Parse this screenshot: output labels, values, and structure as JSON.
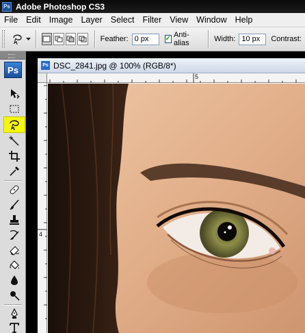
{
  "titlebar": {
    "app_icon": "Ps",
    "title": "Adobe Photoshop CS3"
  },
  "menu": [
    "File",
    "Edit",
    "Image",
    "Layer",
    "Select",
    "Filter",
    "View",
    "Window",
    "Help"
  ],
  "options": {
    "feather_label": "Feather:",
    "feather_value": "0 px",
    "antialias_label": "Anti-alias",
    "antialias_checked": true,
    "width_label": "Width:",
    "width_value": "10 px",
    "contrast_label": "Contrast:"
  },
  "toolbox": {
    "logo": "Ps",
    "tools": [
      "move-tool",
      "marquee-tool",
      "magnetic-lasso-tool",
      "magic-wand-tool",
      "crop-tool",
      "eyedropper-tool",
      "healing-brush-tool",
      "brush-tool",
      "clone-stamp-tool",
      "history-brush-tool",
      "eraser-tool",
      "paint-bucket-tool",
      "blur-tool",
      "dodge-tool",
      "pen-tool",
      "type-tool"
    ],
    "active_tool": "magnetic-lasso-tool",
    "highlight_color": "#f4f800"
  },
  "document": {
    "icon": "Ps",
    "title": "DSC_2841.jpg @ 100% (RGB/8*)",
    "ruler_h_label": "5",
    "ruler_v_label": "4"
  },
  "colors": {
    "titlebar": "#111111",
    "menubar": "#efefef",
    "skin": "#e2b38f",
    "iris": "#8c8a3e"
  }
}
